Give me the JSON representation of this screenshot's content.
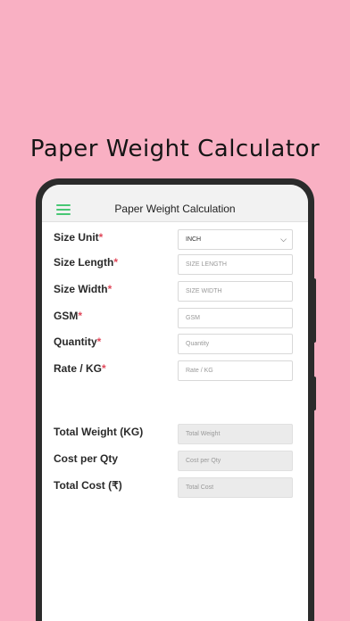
{
  "promo": {
    "title": "Paper Weight Calculator"
  },
  "appbar": {
    "title": "Paper Weight Calculation",
    "menu_icon": "hamburger-menu-icon"
  },
  "form": {
    "inputs": [
      {
        "label": "Size Unit",
        "required": "*",
        "value": "INCH",
        "type": "select"
      },
      {
        "label": "Size Length",
        "required": "*",
        "placeholder": "SIZE LENGTH"
      },
      {
        "label": "Size Width",
        "required": "*",
        "placeholder": "SIZE WIDTH"
      },
      {
        "label": "GSM",
        "required": "*",
        "placeholder": "GSM"
      },
      {
        "label": "Quantity",
        "required": "*",
        "placeholder": "Quantity"
      },
      {
        "label": "Rate / KG",
        "required": "*",
        "placeholder": "Rate / KG"
      }
    ],
    "results": [
      {
        "label": "Total Weight (KG)",
        "placeholder": "Total Weight"
      },
      {
        "label": "Cost per Qty",
        "placeholder": "Cost per Qty"
      },
      {
        "label": "Total Cost (₹)",
        "placeholder": "Total Cost"
      }
    ]
  },
  "colors": {
    "background": "#f9b0c3",
    "accent": "#48c774",
    "required": "#e0485a"
  }
}
